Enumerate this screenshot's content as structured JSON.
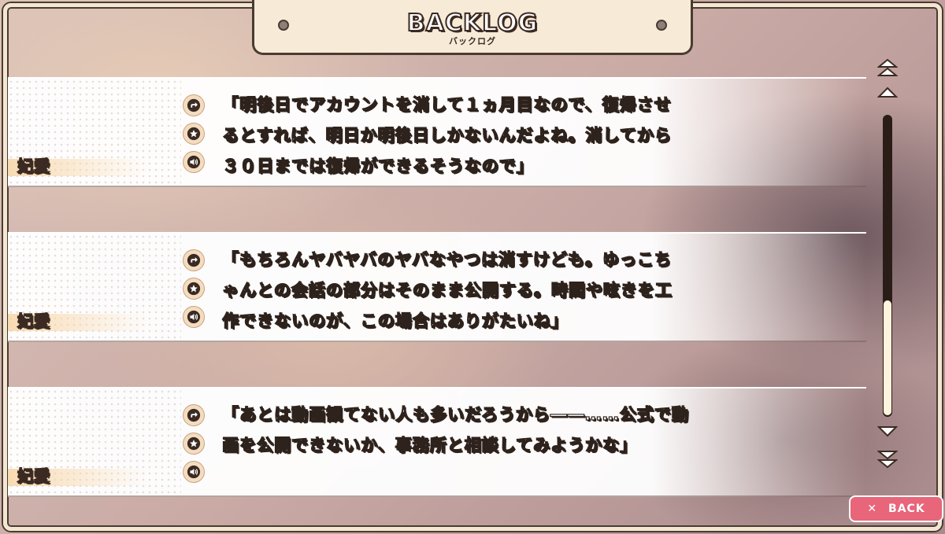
{
  "header": {
    "title": "BACKLOG",
    "subtitle": "バックログ"
  },
  "entries": [
    {
      "speaker": "妃愛",
      "lines": [
        "「明後日でアカウントを消して１ヵ月目なので、復帰させ",
        "るとすれば、明日か明後日しかないんだよね。消してから",
        "３０日までは復帰ができるそうなので」"
      ]
    },
    {
      "speaker": "妃愛",
      "lines": [
        "「もちろんヤバヤバのヤバなやつは消すけども。ゆっこち",
        "ゃんとの会話の部分はそのまま公開する。時間や呟きを工",
        "作できないのが、この場合はありがたいね」"
      ]
    },
    {
      "speaker": "妃愛",
      "lines": [
        "「あとは動画観てない人も多いだろうから――……公式で動",
        "画を公開できないか、事務所と相談してみようかな」",
        ""
      ]
    }
  ],
  "icons": [
    "jump-icon",
    "favorite-star-icon",
    "voice-replay-icon"
  ],
  "scroll": {
    "position": 0.62
  },
  "back_button": {
    "icon": "close-icon",
    "label": "BACK"
  },
  "colors": {
    "accent": "#e8657a",
    "frame": "#f4e7d2",
    "outline": "#4a3b32"
  }
}
